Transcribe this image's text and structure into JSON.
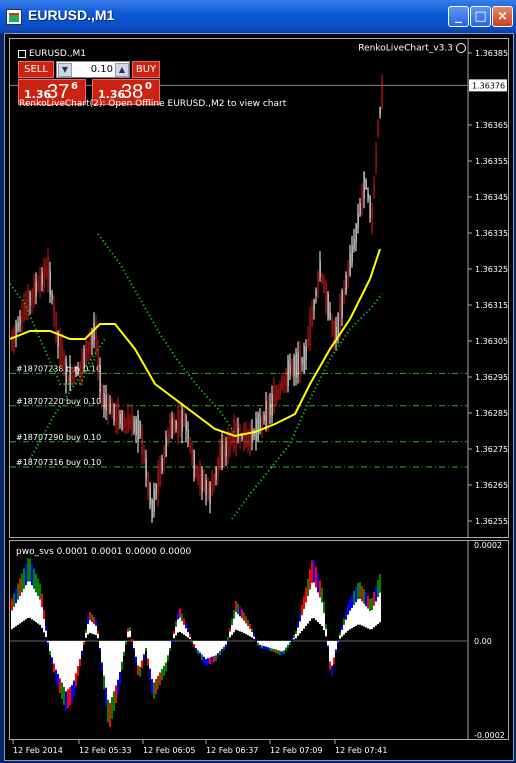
{
  "window": {
    "title": "EURUSD.,M1",
    "minimize": "_",
    "maximize": "□",
    "close": "×"
  },
  "trade_panel": {
    "symbol_label": "EURUSD.,M1",
    "sell_label": "SELL",
    "buy_label": "BUY",
    "lot_value": "0.10",
    "sell_price": {
      "prefix": "1.36",
      "big": "37",
      "sup": "6"
    },
    "buy_price": {
      "prefix": "1.36",
      "big": "38",
      "sup": "0"
    }
  },
  "ea_label": "RenkoLiveChart_v3.3",
  "comment": "RenkoLiveChart(2): Open Offline EURUSD.,M2 to view chart",
  "current_price": "1.36376",
  "price_axis": [
    "1.36385",
    "1.36365",
    "1.36355",
    "1.36345",
    "1.36335",
    "1.36325",
    "1.36315",
    "1.36305",
    "1.36295",
    "1.36285",
    "1.36275",
    "1.36265",
    "1.36255"
  ],
  "orders": [
    {
      "label": "#18707238 buy 0.10",
      "price": 1.36296
    },
    {
      "label": "#18707220 buy 0.10",
      "price": 1.36287
    },
    {
      "label": "#18707290 buy 0.10",
      "price": 1.36277
    },
    {
      "label": "#18707316 buy 0.10",
      "price": 1.3627
    }
  ],
  "indicator": {
    "label": "pwo_svs 0.0001 0.0001 0.0000 0.0000",
    "axis": [
      "0.0002",
      "0.00",
      "-0.0002"
    ]
  },
  "time_axis": [
    "12 Feb 2014",
    "12 Feb 05:33",
    "12 Feb 06:05",
    "12 Feb 06:37",
    "12 Feb 07:09",
    "12 Feb 07:41"
  ],
  "colors": {
    "bull_candle": "#ffffff",
    "bear_candle": "#d01818",
    "ma_line": "#ffff00",
    "envelope": "#22dd22",
    "order_line": "#33aa33",
    "hist_white": "#ffffff",
    "hist_red": "#ff0000",
    "hist_blue": "#0000ff",
    "hist_green": "#008000"
  }
}
